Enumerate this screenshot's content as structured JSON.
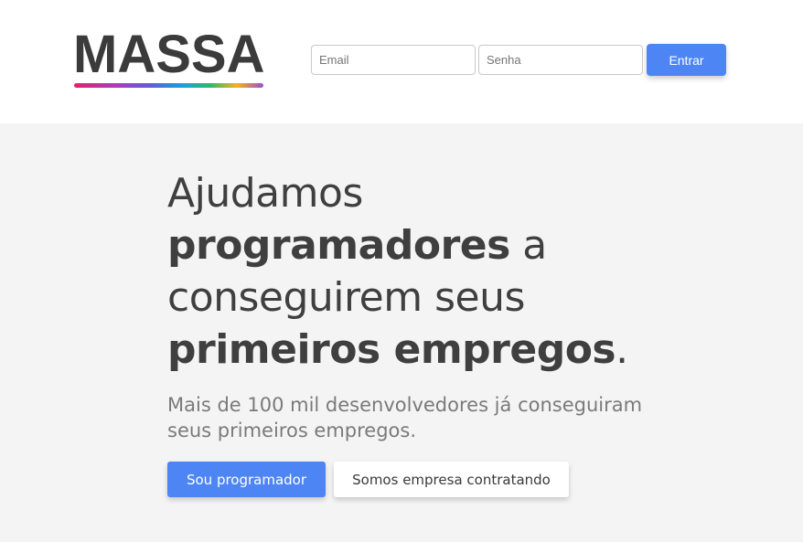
{
  "header": {
    "logo_text": "MASSA",
    "login": {
      "email_placeholder": "Email",
      "password_placeholder": "Senha",
      "submit_label": "Entrar"
    }
  },
  "hero": {
    "headline_line1": "Ajudamos",
    "headline_bold1": "programadores",
    "headline_after1": " a",
    "headline_line3": "conseguirem seus",
    "headline_bold2": "primeiros empregos",
    "headline_end": ".",
    "subtitle": "Mais de 100 mil desenvolvedores já conseguiram seus primeiros empregos.",
    "cta_developer_label": "Sou programador",
    "cta_company_label": "Somos empresa contratando"
  },
  "colors": {
    "accent": "#4d86f4",
    "text_dark": "#3f3f3f",
    "page_bg": "#f4f4f4"
  }
}
